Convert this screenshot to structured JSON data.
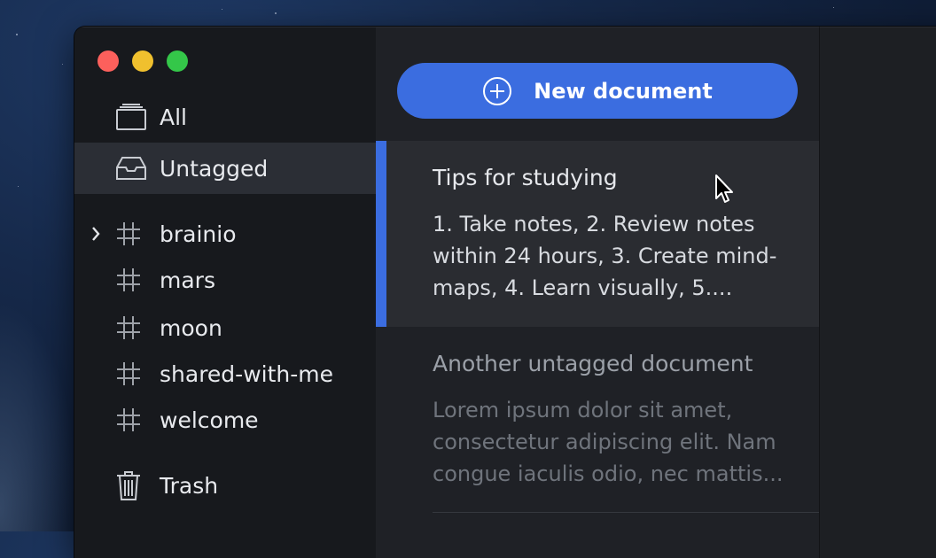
{
  "sidebar": {
    "all_label": "All",
    "untagged_label": "Untagged",
    "tags": [
      {
        "label": "brainio"
      },
      {
        "label": "mars"
      },
      {
        "label": "moon"
      },
      {
        "label": "shared-with-me"
      },
      {
        "label": "welcome"
      }
    ],
    "trash_label": "Trash"
  },
  "list": {
    "new_document_label": "New document",
    "documents": [
      {
        "title": "Tips for studying",
        "snippet": "1. Take notes, 2. Review notes within 24 hours, 3. Create mind-maps, 4. Learn visually, 5...."
      },
      {
        "title": "Another untagged document",
        "snippet": "Lorem ipsum dolor sit amet, consectetur adipiscing elit. Nam congue iaculis odio, nec mattis..."
      }
    ]
  },
  "colors": {
    "accent": "#3b6de0",
    "sidebar_bg": "#17191d",
    "list_bg": "#1f2126",
    "selected_bg": "#2b2e35"
  },
  "icons": {
    "all": "tray-stack-icon",
    "untagged": "inbox-icon",
    "tag": "hash-icon",
    "trash": "trash-icon",
    "new": "plus-circle-icon",
    "expand": "chevron-right-icon"
  }
}
